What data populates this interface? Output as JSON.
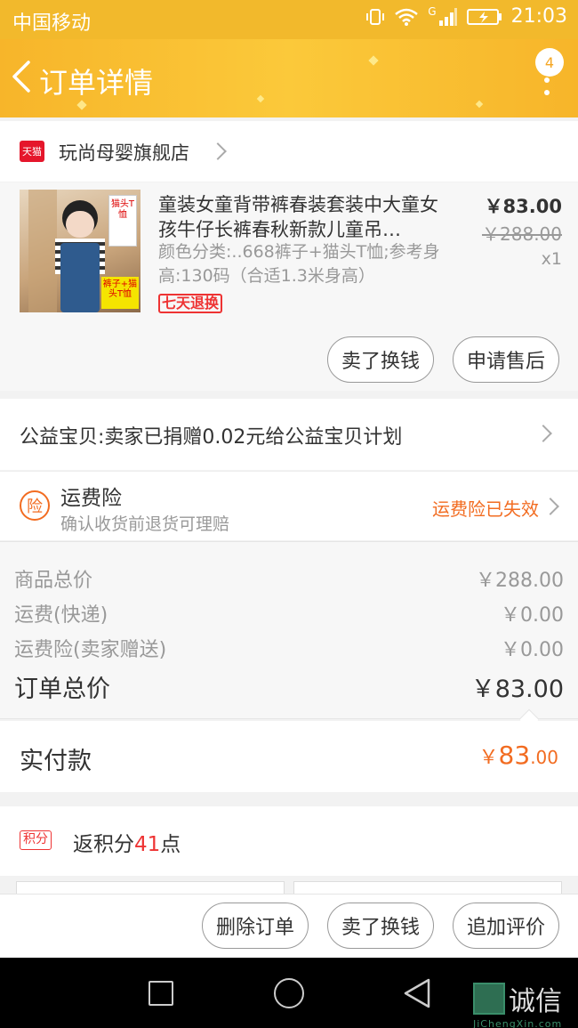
{
  "status_bar": {
    "carrier": "中国移动",
    "network": "G",
    "time": "21:03"
  },
  "header": {
    "title": "订单详情",
    "badge_count": "4"
  },
  "store": {
    "platform_badge": "天猫",
    "name": "玩尚母婴旗舰店"
  },
  "product": {
    "title": "童装女童背带裤春装套装中大童女孩牛仔长裤春秋新款儿童吊…",
    "attributes": "颜色分类:..668裤子+猫头T恤;参考身高:130码（合适1.3米身高）",
    "thumb_label_top": "猫头T恤",
    "thumb_label_bottom": "裤子+猫头T恤",
    "return_tag": "七天退换",
    "price": "￥83.00",
    "original_price": "￥288.00",
    "quantity": "x1",
    "buttons": {
      "sell": "卖了换钱",
      "after_sale": "申请售后"
    }
  },
  "charity": {
    "text": "公益宝贝:卖家已捐赠0.02元给公益宝贝计划"
  },
  "insurance": {
    "icon_text": "险",
    "title": "运费险",
    "subtitle": "确认收货前退货可理赔",
    "status": "运费险已失效"
  },
  "summary": {
    "rows": [
      {
        "label": "商品总价",
        "value": "￥288.00"
      },
      {
        "label": "运费(快递)",
        "value": "￥0.00"
      },
      {
        "label": "运费险(卖家赠送)",
        "value": "￥0.00"
      }
    ],
    "total_label": "订单总价",
    "total_value": "￥83.00"
  },
  "payment": {
    "label": "实付款",
    "currency": "￥",
    "int_part": "83",
    "dec_part": ".00"
  },
  "points": {
    "badge": "积分",
    "prefix": "返积分",
    "value": "41",
    "suffix": "点"
  },
  "bottom_actions": {
    "delete": "删除订单",
    "sell": "卖了换钱",
    "review": "追加评价"
  },
  "watermark": {
    "cn": "诚信",
    "en": "JiChengXin.com"
  },
  "colors": {
    "accent": "#f26c21",
    "header": "#f7b52a",
    "red": "#e5162b"
  }
}
